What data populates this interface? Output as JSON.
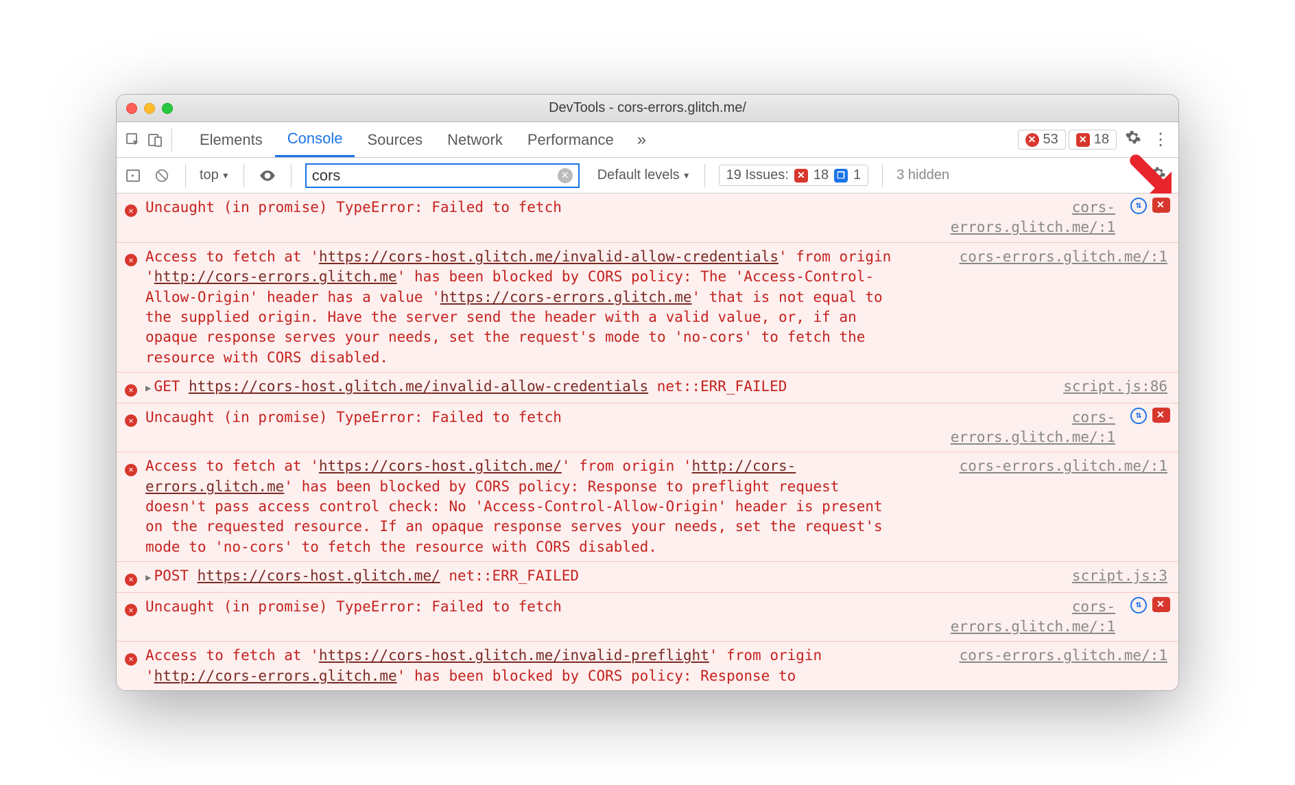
{
  "window": {
    "title": "DevTools - cors-errors.glitch.me/"
  },
  "toolbar": {
    "tabs": [
      "Elements",
      "Console",
      "Sources",
      "Network",
      "Performance"
    ],
    "active_tab_index": 1,
    "more": "»",
    "error_count": "53",
    "issue_error_count": "18"
  },
  "subbar": {
    "context": "top",
    "filter_value": "cors",
    "levels": "Default levels",
    "issues_label": "19 Issues:",
    "issues_err": "18",
    "issues_msg": "1",
    "hidden": "3 hidden"
  },
  "rows": [
    {
      "type": "error",
      "msg_html": "Uncaught (in promise) TypeError: Failed to fetch",
      "src": "cors-errors.glitch.me/:1",
      "has_badges": true
    },
    {
      "type": "error",
      "msg_html": "Access to fetch at '<span class=\"u\">https://cors-host.glitch.me/invalid-allow-credentials</span>' from origin '<span class=\"u\">http://cors-errors.glitch.me</span>' has been blocked by CORS policy: The 'Access-Control-Allow-Origin' header has a value '<span class=\"u\">https://cors-errors.glitch.me</span>' that is not equal to the supplied origin. Have the server send the header with a valid value, or, if an opaque response serves your needs, set the request's mode to 'no-cors' to fetch the resource with CORS disabled.",
      "src": "cors-errors.glitch.me/:1"
    },
    {
      "type": "error",
      "msg_html": "<span class=\"arrow-tog\">▶</span>GET <span class=\"u\">https://cors-host.glitch.me/invalid-allow-credentials</span> <span class=\"net-err\">net::ERR_FAILED</span>",
      "src": "script.js:86"
    },
    {
      "type": "error",
      "msg_html": "Uncaught (in promise) TypeError: Failed to fetch",
      "src": "cors-errors.glitch.me/:1",
      "has_badges": true
    },
    {
      "type": "error",
      "msg_html": "Access to fetch at '<span class=\"u\">https://cors-host.glitch.me/</span>' from origin '<span class=\"u\">http://cors-errors.glitch.me</span>' has been blocked by CORS policy: Response to preflight request doesn't pass access control check: No 'Access-Control-Allow-Origin' header is present on the requested resource. If an opaque response serves your needs, set the request's mode to 'no-cors' to fetch the resource with CORS disabled.",
      "src": "cors-errors.glitch.me/:1"
    },
    {
      "type": "error",
      "msg_html": "<span class=\"arrow-tog\">▶</span>POST <span class=\"u\">https://cors-host.glitch.me/</span> <span class=\"net-err\">net::ERR_FAILED</span>",
      "src": "script.js:3"
    },
    {
      "type": "error",
      "msg_html": "Uncaught (in promise) TypeError: Failed to fetch",
      "src": "cors-errors.glitch.me/:1",
      "has_badges": true
    },
    {
      "type": "error",
      "msg_html": "Access to fetch at '<span class=\"u\">https://cors-host.glitch.me/invalid-preflight</span>' from origin '<span class=\"u\">http://cors-errors.glitch.me</span>' has been blocked by CORS policy: Response to",
      "src": "cors-errors.glitch.me/:1"
    }
  ]
}
